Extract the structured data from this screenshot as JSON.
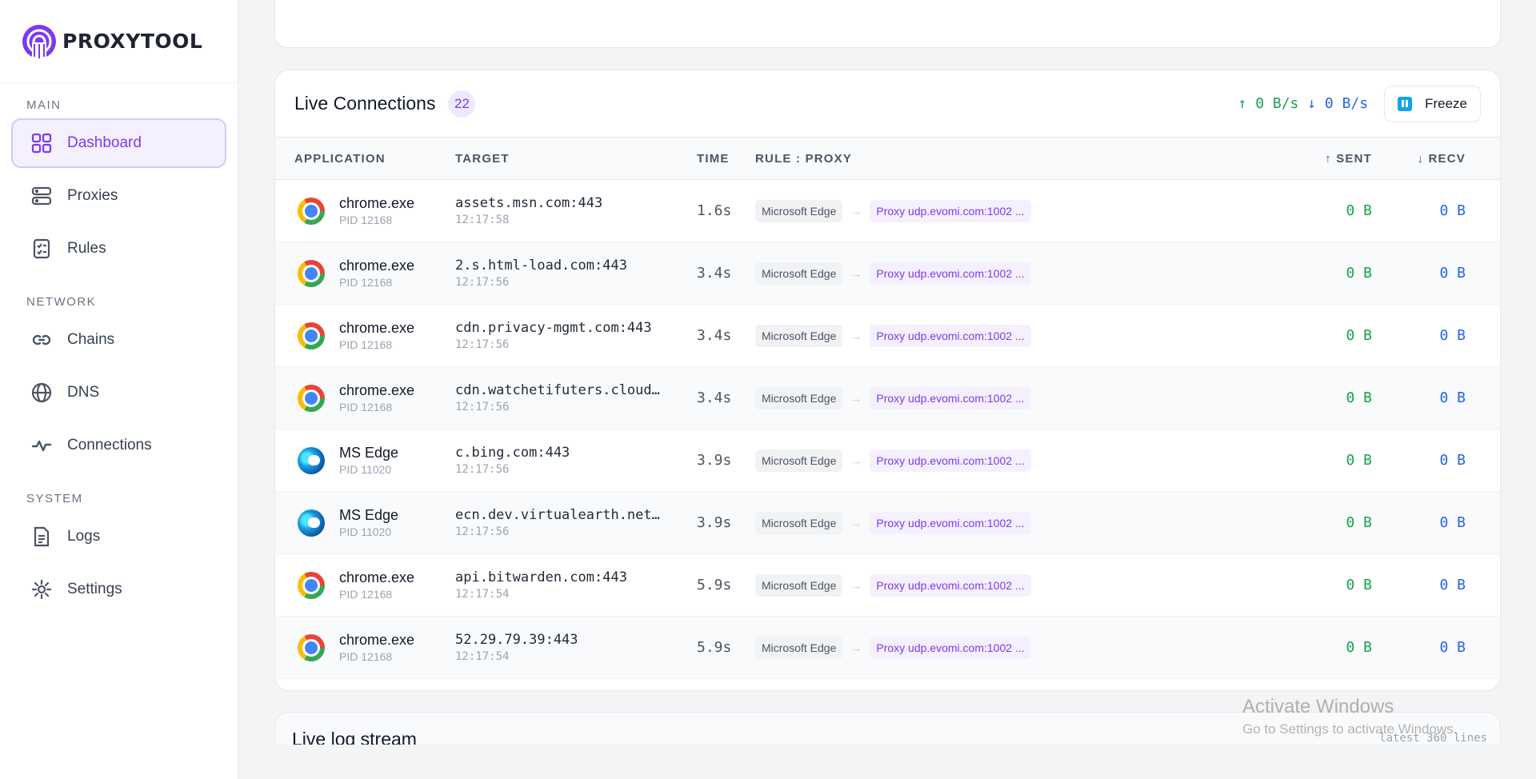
{
  "brand": {
    "name": "PROXYTOOL"
  },
  "sidebar": {
    "sections": [
      {
        "label": "MAIN",
        "items": [
          {
            "label": "Dashboard",
            "icon": "grid-icon",
            "active": true
          },
          {
            "label": "Proxies",
            "icon": "server-icon"
          },
          {
            "label": "Rules",
            "icon": "checklist-icon"
          }
        ]
      },
      {
        "label": "NETWORK",
        "items": [
          {
            "label": "Chains",
            "icon": "chain-icon"
          },
          {
            "label": "DNS",
            "icon": "globe-icon"
          },
          {
            "label": "Connections",
            "icon": "activity-icon"
          }
        ]
      },
      {
        "label": "SYSTEM",
        "items": [
          {
            "label": "Logs",
            "icon": "document-icon"
          },
          {
            "label": "Settings",
            "icon": "gear-icon"
          }
        ]
      }
    ]
  },
  "connections": {
    "title": "Live Connections",
    "count": "22",
    "rate_up": "↑ 0 B/s",
    "rate_down": "↓ 0 B/s",
    "freeze_label": "Freeze",
    "headers": {
      "app": "APPLICATION",
      "target": "TARGET",
      "time": "TIME",
      "rule": "RULE : PROXY",
      "sent": "↑ SENT",
      "recv": "↓ RECV"
    },
    "rows": [
      {
        "icon": "chrome",
        "app": "chrome.exe",
        "pid": "PID 12168",
        "target": "assets.msn.com:443",
        "ts": "12:17:58",
        "time": "1.6s",
        "rule": "Microsoft Edge",
        "proxy": "Proxy udp.evomi.com:1002 ...",
        "sent": "0 B",
        "recv": "0 B"
      },
      {
        "icon": "chrome",
        "app": "chrome.exe",
        "pid": "PID 12168",
        "target": "2.s.html-load.com:443",
        "ts": "12:17:56",
        "time": "3.4s",
        "rule": "Microsoft Edge",
        "proxy": "Proxy udp.evomi.com:1002 ...",
        "sent": "0 B",
        "recv": "0 B"
      },
      {
        "icon": "chrome",
        "app": "chrome.exe",
        "pid": "PID 12168",
        "target": "cdn.privacy-mgmt.com:443",
        "ts": "12:17:56",
        "time": "3.4s",
        "rule": "Microsoft Edge",
        "proxy": "Proxy udp.evomi.com:1002 ...",
        "sent": "0 B",
        "recv": "0 B"
      },
      {
        "icon": "chrome",
        "app": "chrome.exe",
        "pid": "PID 12168",
        "target": "cdn.watchetifuters.cloud…",
        "ts": "12:17:56",
        "time": "3.4s",
        "rule": "Microsoft Edge",
        "proxy": "Proxy udp.evomi.com:1002 ...",
        "sent": "0 B",
        "recv": "0 B"
      },
      {
        "icon": "edge",
        "app": "MS Edge",
        "pid": "PID 11020",
        "target": "c.bing.com:443",
        "ts": "12:17:56",
        "time": "3.9s",
        "rule": "Microsoft Edge",
        "proxy": "Proxy udp.evomi.com:1002 ...",
        "sent": "0 B",
        "recv": "0 B"
      },
      {
        "icon": "edge",
        "app": "MS Edge",
        "pid": "PID 11020",
        "target": "ecn.dev.virtualearth.net…",
        "ts": "12:17:56",
        "time": "3.9s",
        "rule": "Microsoft Edge",
        "proxy": "Proxy udp.evomi.com:1002 ...",
        "sent": "0 B",
        "recv": "0 B"
      },
      {
        "icon": "chrome",
        "app": "chrome.exe",
        "pid": "PID 12168",
        "target": "api.bitwarden.com:443",
        "ts": "12:17:54",
        "time": "5.9s",
        "rule": "Microsoft Edge",
        "proxy": "Proxy udp.evomi.com:1002 ...",
        "sent": "0 B",
        "recv": "0 B"
      },
      {
        "icon": "chrome",
        "app": "chrome.exe",
        "pid": "PID 12168",
        "target": "52.29.79.39:443",
        "ts": "12:17:54",
        "time": "5.9s",
        "rule": "Microsoft Edge",
        "proxy": "Proxy udp.evomi.com:1002 ...",
        "sent": "0 B",
        "recv": "0 B"
      }
    ]
  },
  "log": {
    "title": "Live log stream",
    "meta": "latest 360 lines"
  },
  "watermark": {
    "title": "Activate Windows",
    "subtitle": "Go to Settings to activate Windows."
  },
  "colors": {
    "accent": "#7c3aed",
    "sent": "#16a34a",
    "recv": "#2563eb"
  }
}
